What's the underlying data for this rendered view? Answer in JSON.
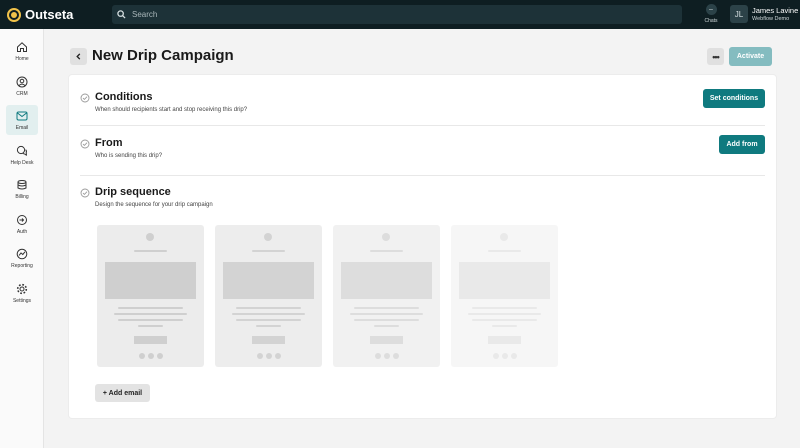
{
  "app": {
    "name": "Outseta"
  },
  "search": {
    "placeholder": "Search"
  },
  "topbar": {
    "chats_label": "Chats"
  },
  "user": {
    "initials": "JL",
    "name": "James Lavine",
    "org": "Webflow Demo"
  },
  "sidebar": {
    "items": [
      {
        "label": "Home",
        "icon": "home-icon"
      },
      {
        "label": "CRM",
        "icon": "user-circle-icon"
      },
      {
        "label": "Email",
        "icon": "envelope-icon",
        "active": true
      },
      {
        "label": "Help Desk",
        "icon": "chat-bubbles-icon"
      },
      {
        "label": "Billing",
        "icon": "coins-icon"
      },
      {
        "label": "Auth",
        "icon": "key-icon"
      },
      {
        "label": "Reporting",
        "icon": "chart-line-icon"
      },
      {
        "label": "Settings",
        "icon": "gear-icon"
      }
    ]
  },
  "header": {
    "title": "New Drip Campaign",
    "more_label": "•••",
    "activate_label": "Activate"
  },
  "sections": {
    "conditions": {
      "title": "Conditions",
      "subtitle": "When should recipients start and stop receiving this drip?",
      "button": "Set conditions"
    },
    "from": {
      "title": "From",
      "subtitle": "Who is sending this drip?",
      "button": "Add from"
    },
    "sequence": {
      "title": "Drip sequence",
      "subtitle": "Design the sequence for your drip campaign",
      "add_button": "+ Add email"
    }
  },
  "colors": {
    "topbar": "#0e1e22",
    "primary": "#0f7a7f",
    "activate_disabled": "#84bcc0",
    "accent_logo": "#f1c34a"
  }
}
